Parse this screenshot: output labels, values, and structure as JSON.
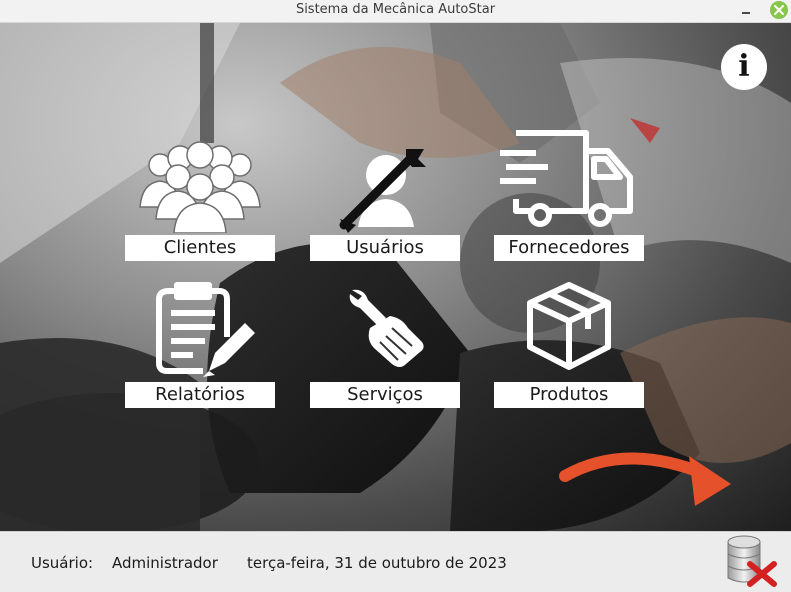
{
  "window": {
    "title": "Sistema da Mecânica AutoStar"
  },
  "main": {
    "tiles": [
      {
        "label": "Clientes",
        "icon": "users-group-icon"
      },
      {
        "label": "Usuários",
        "icon": "user-wrench-icon"
      },
      {
        "label": "Fornecedores",
        "icon": "delivery-truck-icon"
      },
      {
        "label": "Relatórios",
        "icon": "clipboard-pencil-icon"
      },
      {
        "label": "Serviços",
        "icon": "wrench-hand-icon"
      },
      {
        "label": "Produtos",
        "icon": "product-box-icon"
      }
    ],
    "info_icon": "info-icon",
    "arrow_color": "#e5512b"
  },
  "status": {
    "user_label": "Usuário:",
    "user_value": "Administrador",
    "date": "terça-feira, 31 de outubro de 2023",
    "db_icon": "database-disconnect-icon"
  }
}
